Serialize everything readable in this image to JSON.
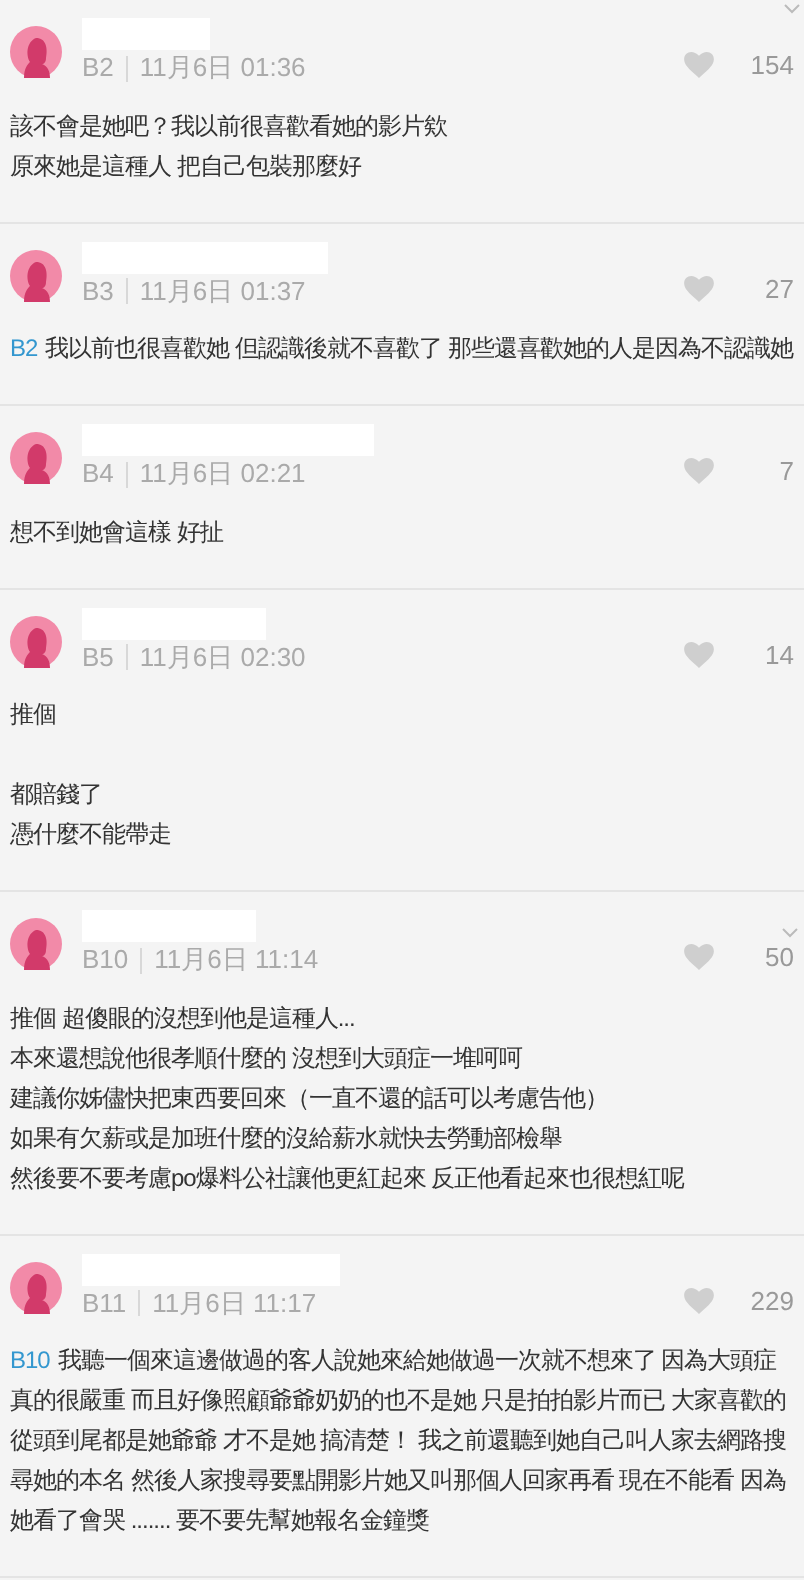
{
  "comments": [
    {
      "floor": "B2",
      "time": "11月6日 01:36",
      "likes": "154",
      "paragraphs": [
        [
          "該不會是她吧？我以前很喜歡看她的影片欸",
          "原來她是這種人 把自己包裝那麼好"
        ]
      ]
    },
    {
      "floor": "B3",
      "time": "11月6日 01:37",
      "likes": "27",
      "reply_to": "B2",
      "paragraphs": [
        [
          "我以前也很喜歡她 但認識後就不喜歡了 那些還喜歡她的人是因為不認識她"
        ]
      ]
    },
    {
      "floor": "B4",
      "time": "11月6日 02:21",
      "likes": "7",
      "paragraphs": [
        [
          "想不到她會這樣 好扯"
        ]
      ]
    },
    {
      "floor": "B5",
      "time": "11月6日 02:30",
      "likes": "14",
      "paragraphs": [
        [
          "推個"
        ],
        [
          "都賠錢了",
          "憑什麼不能帶走"
        ]
      ]
    },
    {
      "floor": "B10",
      "time": "11月6日 11:14",
      "likes": "50",
      "paragraphs": [
        [
          "推個 超傻眼的沒想到他是這種人...",
          "本來還想說他很孝順什麼的 沒想到大頭症一堆呵呵",
          "建議你姊儘快把東西要回來（一直不還的話可以考慮告他）",
          "如果有欠薪或是加班什麼的沒給薪水就快去勞動部檢舉",
          "然後要不要考慮po爆料公社讓他更紅起來 反正他看起來也很想紅呢"
        ]
      ]
    },
    {
      "floor": "B11",
      "time": "11月6日 11:17",
      "likes": "229",
      "reply_to": "B10",
      "paragraphs": [
        [
          "我聽一個來這邊做過的客人說她來給她做過一次就不想來了 因為大頭症真的很嚴重 而且好像照顧爺爺奶奶的也不是她 只是拍拍影片而已 大家喜歡的從頭到尾都是她爺爺 才不是她 搞清楚！ 我之前還聽到她自己叫人家去網路搜尋她的本名 然後人家搜尋要點開影片她又叫那個人回家再看 現在不能看 因為她看了會哭 ....... 要不要先幫她報名金鐘獎"
        ]
      ]
    }
  ]
}
